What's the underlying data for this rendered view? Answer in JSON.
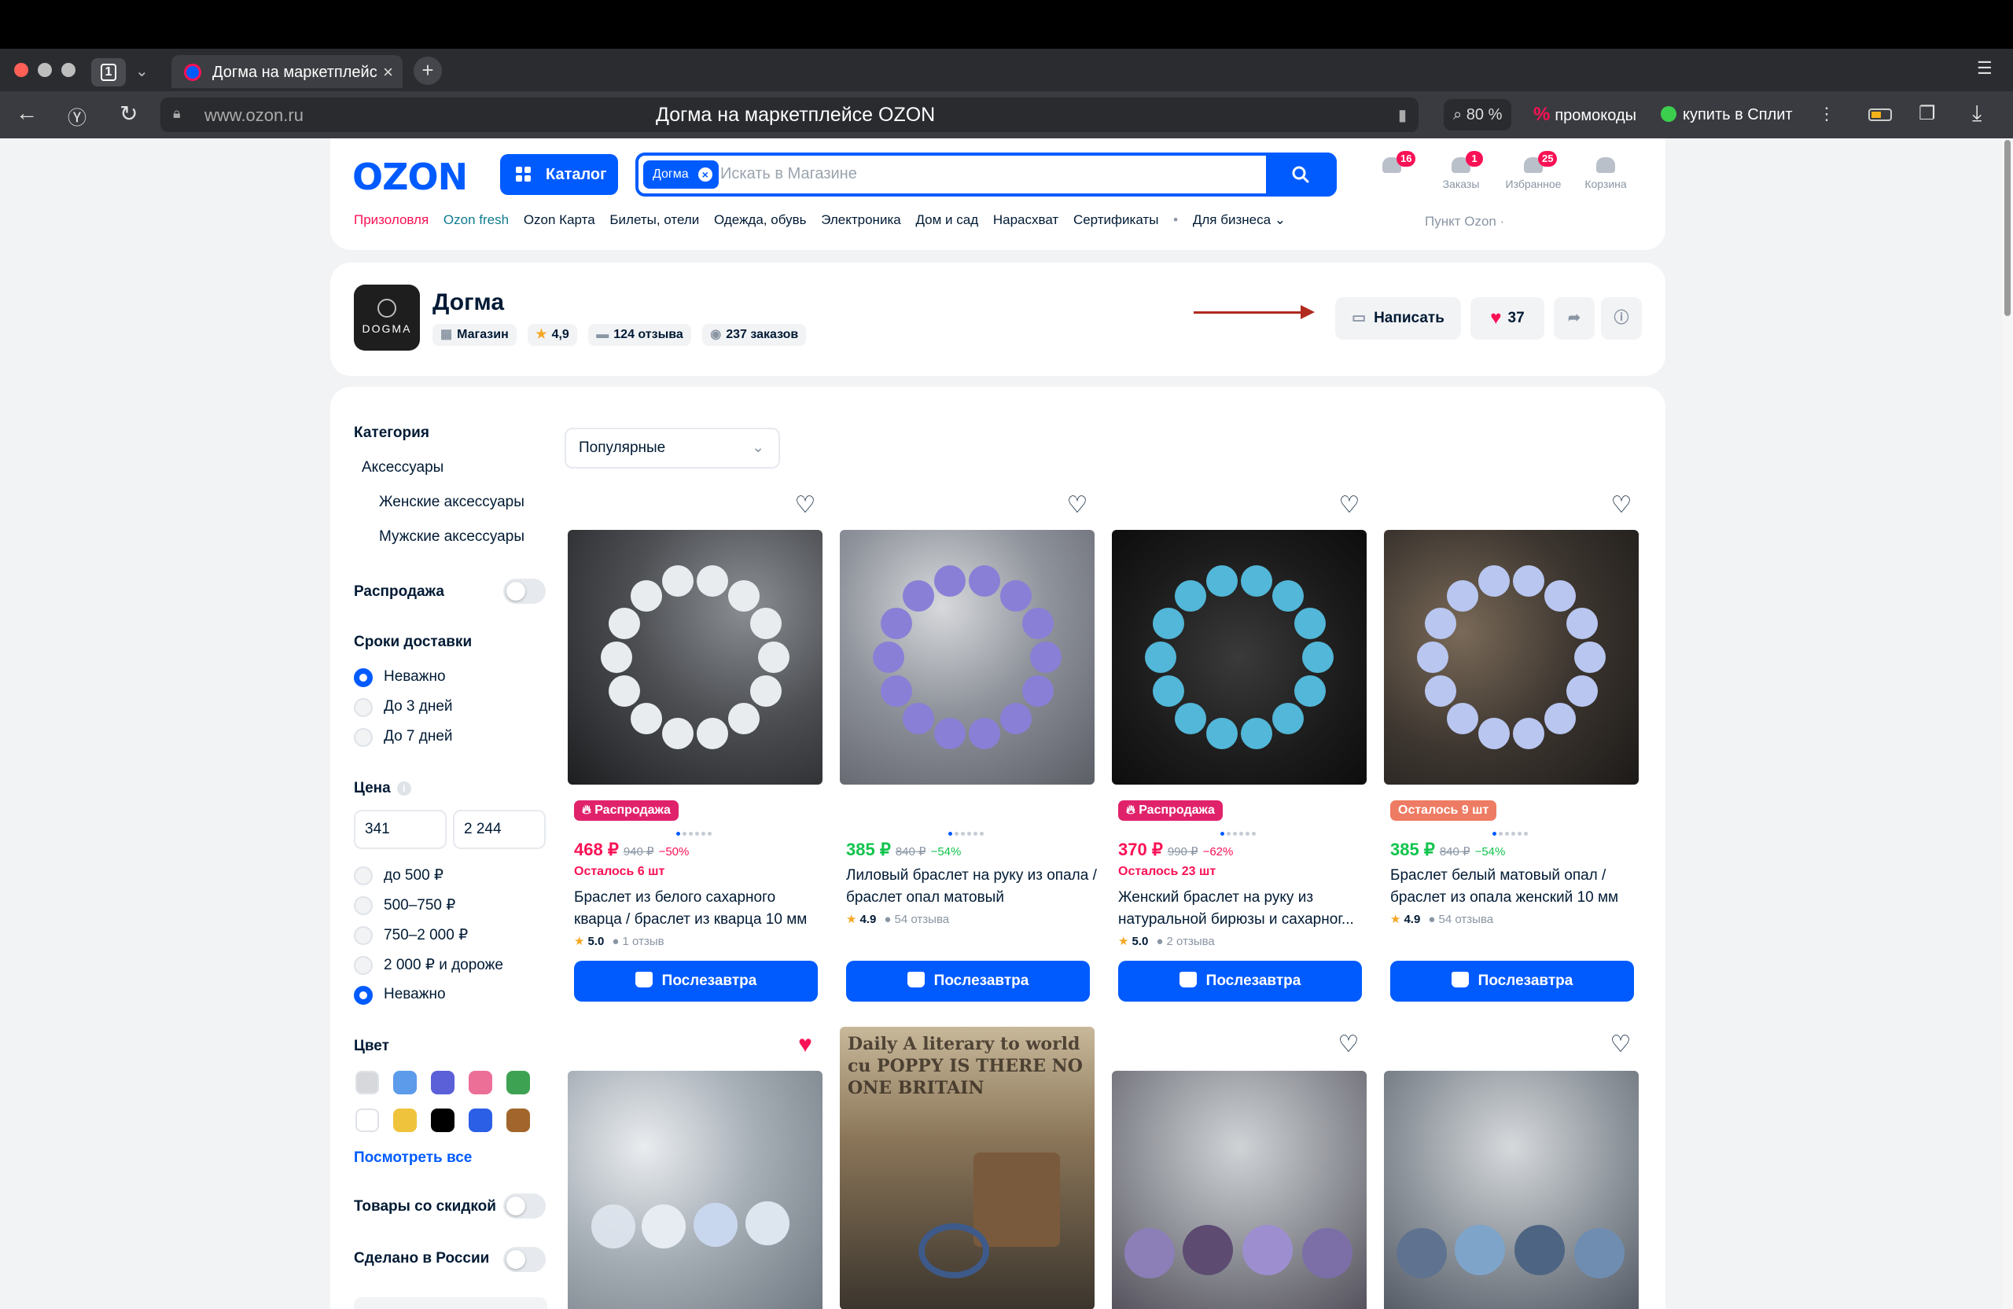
{
  "browser": {
    "tab_count": "1",
    "tab_title": "Догма на маркетплейсе OZON",
    "address_url": "www.ozon.ru",
    "page_title": "Догма на маркетплейсе OZON",
    "zoom": "80 %",
    "promo_label": "промокоды",
    "split_label": "купить в Сплит"
  },
  "header": {
    "logo": "OZON",
    "catalog_label": "Каталог",
    "search_chip": "Догма",
    "search_placeholder": "Искать в Магазине",
    "icons": [
      {
        "label": "",
        "badge": "16"
      },
      {
        "label": "Заказы",
        "badge": "1"
      },
      {
        "label": "Избранное",
        "badge": "25"
      },
      {
        "label": "Корзина",
        "badge": ""
      }
    ],
    "menu": [
      "Призоловля",
      "Ozon fresh",
      "Ozon Карта",
      "Билеты, отели",
      "Одежда, обувь",
      "Электроника",
      "Дом и сад",
      "Нарасхват",
      "Сертификаты",
      "•",
      "Для бизнеса ⌄"
    ],
    "pickup": "Пункт Ozon ·"
  },
  "shop": {
    "logo_text": "DOGMA",
    "name": "Догма",
    "type": "Магазин",
    "rating": "4,9",
    "reviews": "124 отзыва",
    "orders": "237 заказов",
    "write_label": "Написать",
    "likes": "37"
  },
  "filters": {
    "category_title": "Категория",
    "categories": [
      "Аксессуары",
      "Женские аксессуары",
      "Мужские аксессуары"
    ],
    "sale_label": "Распродажа",
    "delivery_title": "Сроки доставки",
    "delivery_options": [
      "Неважно",
      "До 3 дней",
      "До 7 дней"
    ],
    "price_title": "Цена",
    "price_from": "341",
    "price_to": "2 244",
    "price_options": [
      "до 500 ₽",
      "500–750 ₽",
      "750–2 000 ₽",
      "2 000 ₽ и дороже",
      "Неважно"
    ],
    "color_title": "Цвет",
    "colors": [
      "#d6d8dc",
      "#5b9bea",
      "#5b5fd8",
      "#ec6f98",
      "#3ea253",
      "#ffffff",
      "#f0c33c",
      "#000000",
      "#2b5fe6",
      "#a2662c"
    ],
    "see_all": "Посмотреть все",
    "discount_label": "Товары со скидкой",
    "russia_label": "Сделано в России"
  },
  "sort": {
    "selected": "Популярные"
  },
  "products": [
    {
      "tag": "Распродажа",
      "tag_color": "#e0226b",
      "price": "468 ₽",
      "old_price": "940 ₽",
      "discount": "−50%",
      "price_color": "#f91155",
      "note": "Осталось 6 шт",
      "name": "Браслет из белого сахарного кварца / браслет из кварца 10 мм",
      "rating": "5.0",
      "reviews": "1 отзыв",
      "buy": "Послезавтра"
    },
    {
      "tag": "",
      "tag_color": "",
      "price": "385 ₽",
      "old_price": "840 ₽",
      "discount": "−54%",
      "price_color": "#10c44c",
      "note": "",
      "name": "Лиловый браслет на руку из опала /браслет опал матовый",
      "rating": "4.9",
      "reviews": "54 отзыва",
      "buy": "Послезавтра"
    },
    {
      "tag": "Распродажа",
      "tag_color": "#e0226b",
      "price": "370 ₽",
      "old_price": "990 ₽",
      "discount": "−62%",
      "price_color": "#f91155",
      "note": "Осталось 23 шт",
      "name": "Женский браслет на руку из натуральной бирюзы и сахарног...",
      "rating": "5.0",
      "reviews": "2 отзыва",
      "buy": "Послезавтра"
    },
    {
      "tag": "Осталось 9 шт",
      "tag_color": "#ee7b63",
      "price": "385 ₽",
      "old_price": "840 ₽",
      "discount": "−54%",
      "price_color": "#10c44c",
      "note": "",
      "name": "Браслет белый матовый опал / браслет из опала женский 10 мм",
      "rating": "4.9",
      "reviews": "54 отзыва",
      "buy": "Послезавтра"
    }
  ],
  "newspaper_text": "Daily A literary to world cu POPPY IS THERE NO ONE BRITAIN"
}
